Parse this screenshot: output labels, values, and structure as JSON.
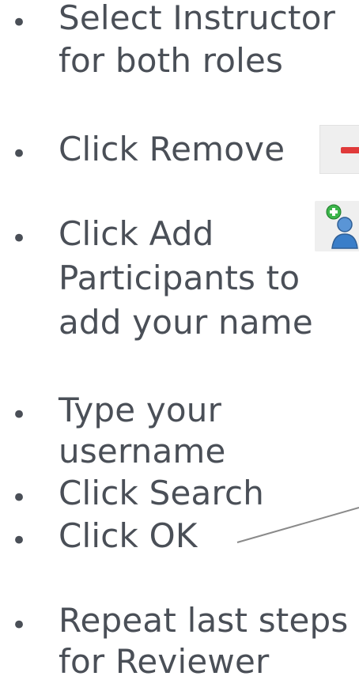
{
  "steps": [
    {
      "lines": [
        "Select Instructor",
        "for both roles"
      ]
    },
    {
      "lines": [
        "Click Remove"
      ]
    },
    {
      "lines": [
        "Click Add",
        "Participants to",
        "add your name"
      ]
    },
    {
      "lines": [
        "Type your",
        "username"
      ]
    },
    {
      "lines": [
        "Click Search"
      ]
    },
    {
      "lines": [
        "Click OK"
      ]
    },
    {
      "lines": [
        "Repeat last steps",
        "for Reviewer"
      ]
    }
  ],
  "icons": {
    "remove": "remove-icon",
    "add_participant": "add-participant-icon",
    "remove_color": "#e03a3a",
    "add_plus_color": "#3bb54a",
    "person_color": "#3a7ec9"
  },
  "bullet_char": "•"
}
